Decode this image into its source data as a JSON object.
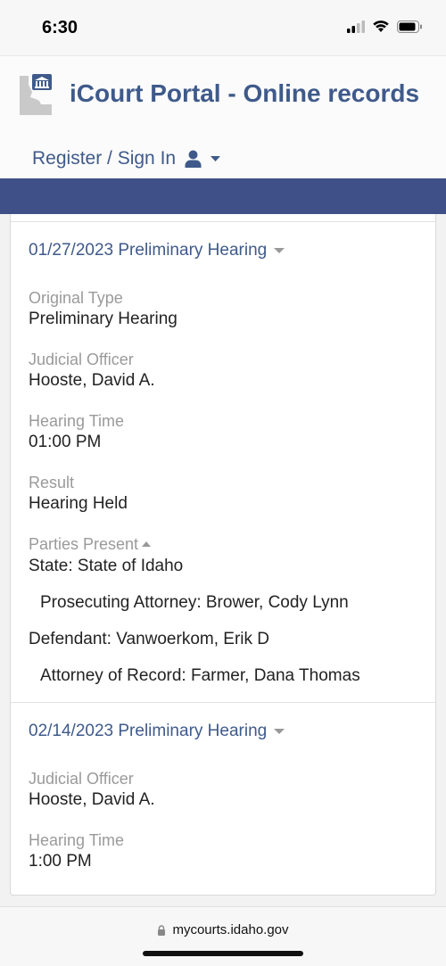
{
  "status_bar": {
    "time": "6:30"
  },
  "header": {
    "title": "iCourt Portal - Online records",
    "signin_label": "Register / Sign In"
  },
  "events": [
    {
      "title": "01/27/2023 Preliminary Hearing",
      "fields": [
        {
          "label": "Original Type",
          "value": "Preliminary Hearing"
        },
        {
          "label": "Judicial Officer",
          "value": "Hooste, David A."
        },
        {
          "label": "Hearing Time",
          "value": "01:00 PM"
        },
        {
          "label": "Result",
          "value": "Hearing Held"
        }
      ],
      "parties_label": "Parties Present",
      "parties": [
        "State: State of Idaho",
        "Prosecuting Attorney: Brower, Cody Lynn",
        "Defendant: Vanwoerkom, Erik D",
        "Attorney of Record: Farmer, Dana Thomas"
      ]
    },
    {
      "title": "02/14/2023 Preliminary Hearing",
      "fields": [
        {
          "label": "Judicial Officer",
          "value": "Hooste, David A."
        },
        {
          "label": "Hearing Time",
          "value": "1:00 PM"
        }
      ]
    }
  ],
  "browser": {
    "url": "mycourts.idaho.gov"
  },
  "colors": {
    "brand": "#3f5a8a",
    "navbar": "#3f5088",
    "label": "#9a9a9a"
  },
  "icons": [
    "signal-icon",
    "wifi-icon",
    "battery-icon",
    "idaho-courthouse-logo-icon",
    "user-icon",
    "chevron-down-icon",
    "caret-down-icon",
    "caret-up-icon",
    "lock-icon"
  ]
}
